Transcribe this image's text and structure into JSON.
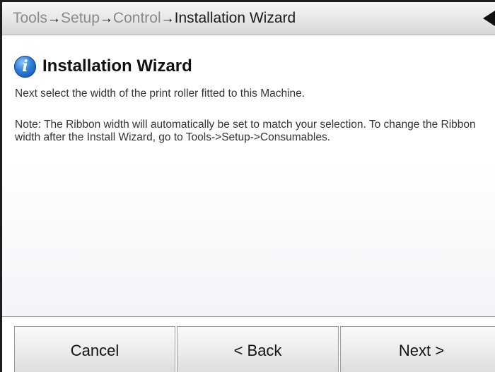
{
  "breadcrumb": {
    "items": [
      "Tools",
      "Setup",
      "Control",
      "Installation Wizard"
    ],
    "separator": "→"
  },
  "header": {
    "title": "Installation Wizard",
    "info_icon_glyph": "i"
  },
  "body": {
    "line1": "Next select the width of the print roller fitted to this Machine.",
    "note": "Note: The Ribbon width will automatically be set to match your selection. To change the Ribbon width after the Install Wizard, go to Tools->Setup->Consumables."
  },
  "buttons": {
    "cancel": "Cancel",
    "back": "< Back",
    "next": "Next >"
  },
  "icons": {
    "info": "info-icon",
    "back": "back-arrow-icon"
  }
}
